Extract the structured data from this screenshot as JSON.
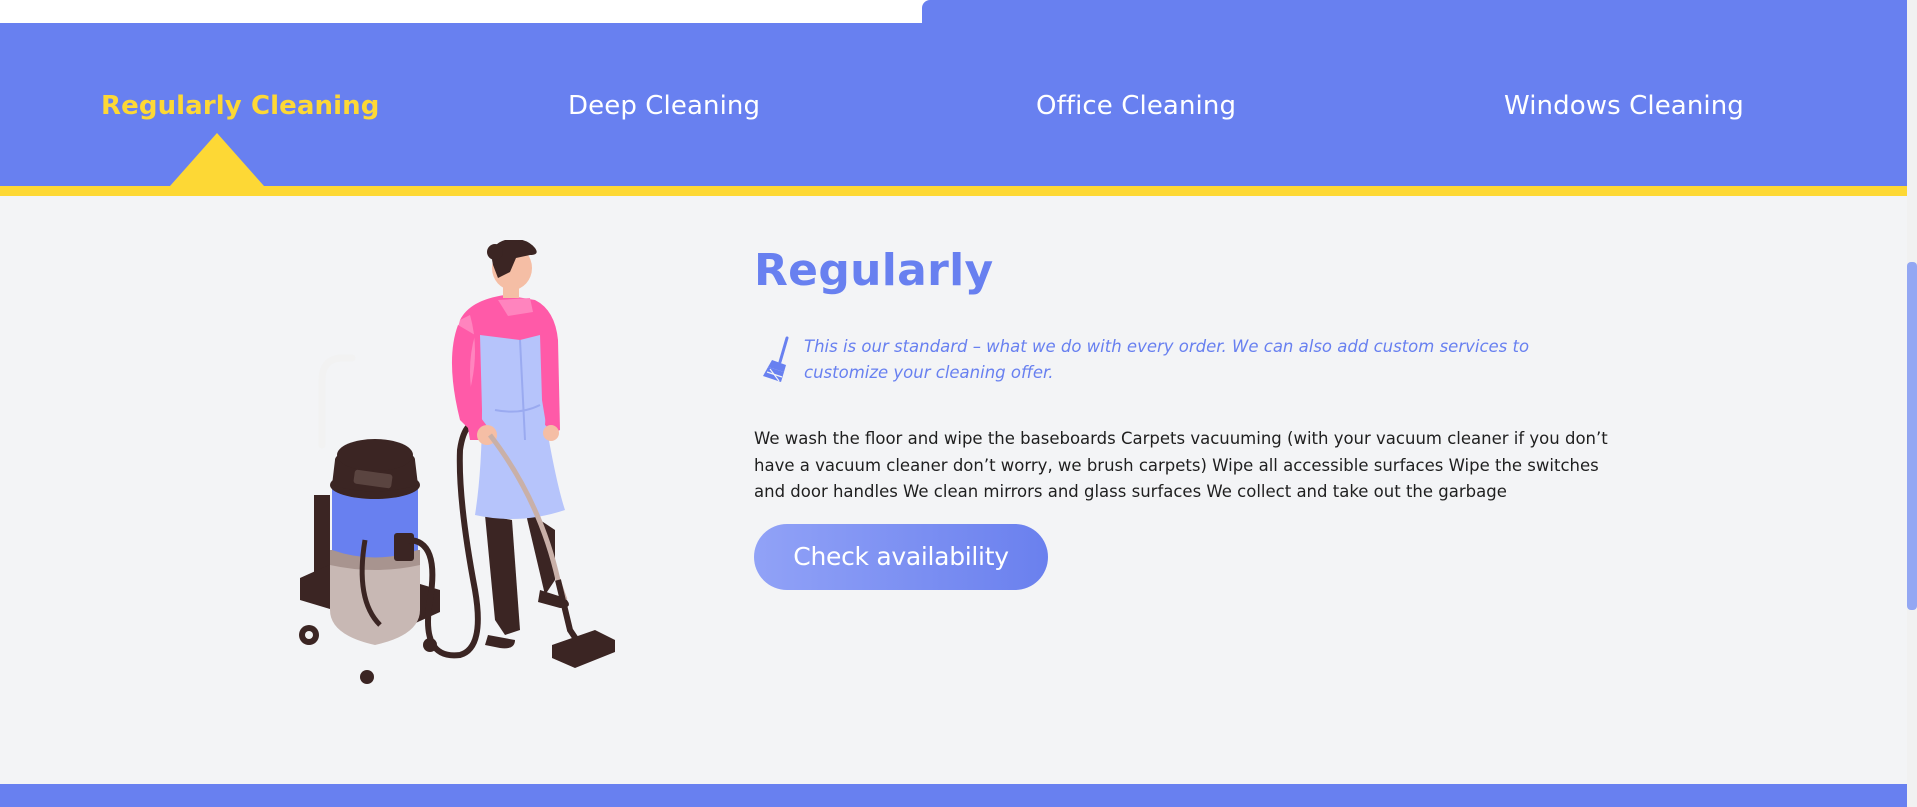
{
  "tabs": [
    {
      "label": "Regularly Cleaning",
      "active": true
    },
    {
      "label": "Deep Cleaning",
      "active": false
    },
    {
      "label": "Office Cleaning",
      "active": false
    },
    {
      "label": "Windows Cleaning",
      "active": false
    }
  ],
  "panel": {
    "heading": "Regularly",
    "tagline": "This is our standard – what we do with every order. We can also add custom services to customize your cleaning offer.",
    "description": "We wash the floor and wipe the baseboards Carpets vacuuming (with your vacuum cleaner if you don’t have a vacuum cleaner don’t worry, we brush carpets) Wipe all accessible surfaces Wipe the switches and door handles We clean mirrors and glass surfaces We collect and take out the garbage",
    "cta_label": "Check availability",
    "tagline_icon": "broom-icon",
    "illustration": "cleaner-with-vacuum-illustration"
  },
  "colors": {
    "brand_blue": "#6880f0",
    "accent_yellow": "#fdd835",
    "content_bg": "#f3f4f6"
  }
}
